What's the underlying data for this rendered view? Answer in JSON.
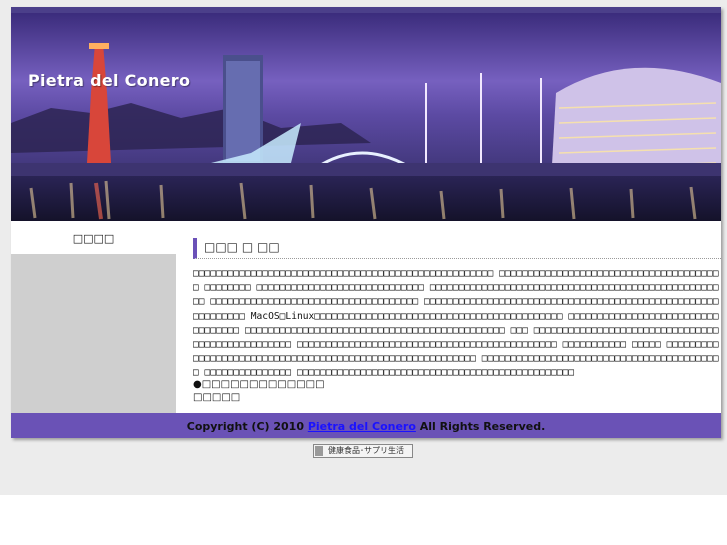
{
  "site": {
    "title": "Pietra del Conero"
  },
  "sidebar": {
    "title": "□□□□"
  },
  "content": {
    "heading": "□□□ □ □□",
    "paragraph": "□□□□□□□□□□□□□□□□□□□□□□□□□□□□□□□□□□□□□□□□□□□□□□□□□□□□ □□□□□□□□□□□□□□□□□□□□□□□□□□□□□□□□□□□□□□□ □□□□□□□□ □□□□□□□□□□□□□□□□□□□□□□□□□□□□□ □□□□□□□□□□□□□□□□□□□□□□□□□□□□□□□□□□□□□□□□□□□□□□□□□□□□ □□□□□□□□□□□□□□□□□□□□□□□□□□□□□□□□□□□□ □□□□□□□□□□□□□□□□□□□□□□□□□□□□□□□□□□□□□□□□□□□□□□□□□□□□□□□□□□□□ MacOS□Linux□□□□□□□□□□□□□□□□□□□□□□□□□□□□□□□□□□□□□□□□□□□ □□□□□□□□□□□□□□□□□□□□□□□□□□□□□□□□□□ □□□□□□□□□□□□□□□□□□□□□□□□□□□□□□□□□□□□□□□□□□□□□ □□□ □□□□□□□□□□□□□□□□□□□□□□□□□□□□□□□□□□□□□□□□□□□□□□□□□ □□□□□□□□□□□□□□□□□□□□□□□□□□□□□□□□□□□□□□□□□□□□□ □□□□□□□□□□□ □□□□□ □□□□□□□□□□□□□□□□□□□□□□□□□□□□□□□□□□□□□□□□□□□□□□□□□□□□□□□□□□ □□□□□□□□□□□□□□□□□□□□□□□□□□□□□□□□□□□□□□□□□□ □□□□□□□□□□□□□□□ □□□□□□□□□□□□□□□□□□□□□□□□□□□□□□□□□□□□□□□□□□□□□□□□",
    "bullet": "●□□□□□□□□□□□□□",
    "sub": "□□□□□"
  },
  "footer": {
    "prefix": "Copyright (C) 2010 ",
    "link": "Pietra del Conero",
    "suffix": " All Rights Reserved."
  },
  "badge": {
    "text": "健康食品･サプリ生活"
  },
  "colors": {
    "accent": "#6a52b6",
    "sidebar_box": "#cfcfcf",
    "page_background": "#ececec",
    "link": "#1a12ff"
  }
}
